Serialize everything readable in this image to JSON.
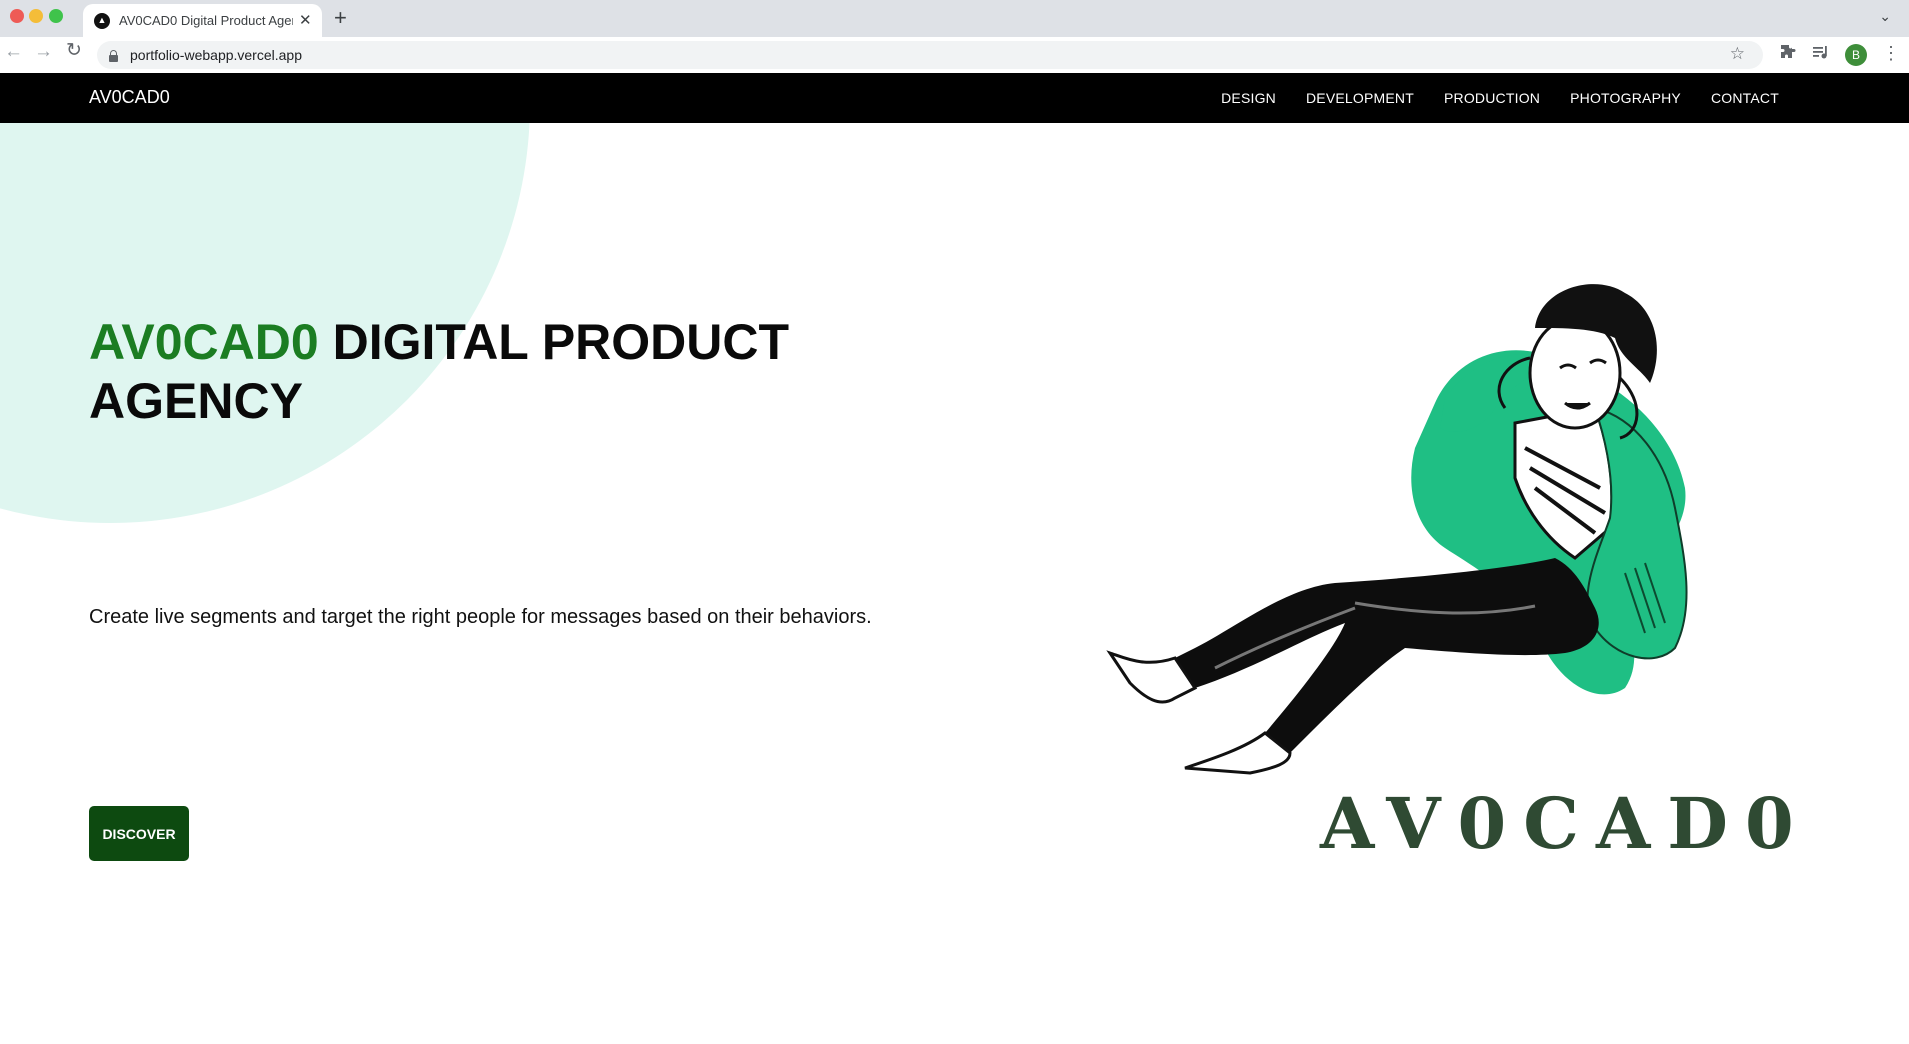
{
  "browser": {
    "tab_title": "AV0CAD0 Digital Product Agency",
    "new_tab_label": "+",
    "close_label": "✕",
    "url": "portfolio-webapp.vercel.app",
    "profile_initial": "B"
  },
  "site": {
    "brand": "AV0CAD0",
    "nav": [
      "DESIGN",
      "DEVELOPMENT",
      "PRODUCTION",
      "PHOTOGRAPHY",
      "CONTACT"
    ],
    "hero": {
      "headline_accent": "AV0CAD0",
      "headline_rest": " DIGITAL PRODUCT AGENCY",
      "subtitle": "Create live segments and target the right people for messages based on their behaviors.",
      "cta_label": "DISCOVER"
    },
    "illustration": {
      "logo_text": "AV0CAD0",
      "icon": "man-relaxing-illustration"
    }
  },
  "colors": {
    "accent_green": "#1b7d22",
    "button_green": "#0d4a10",
    "blob_mint": "#dff6f0",
    "jacket_green": "#1fbf84",
    "logo_green": "#2f4a33"
  }
}
